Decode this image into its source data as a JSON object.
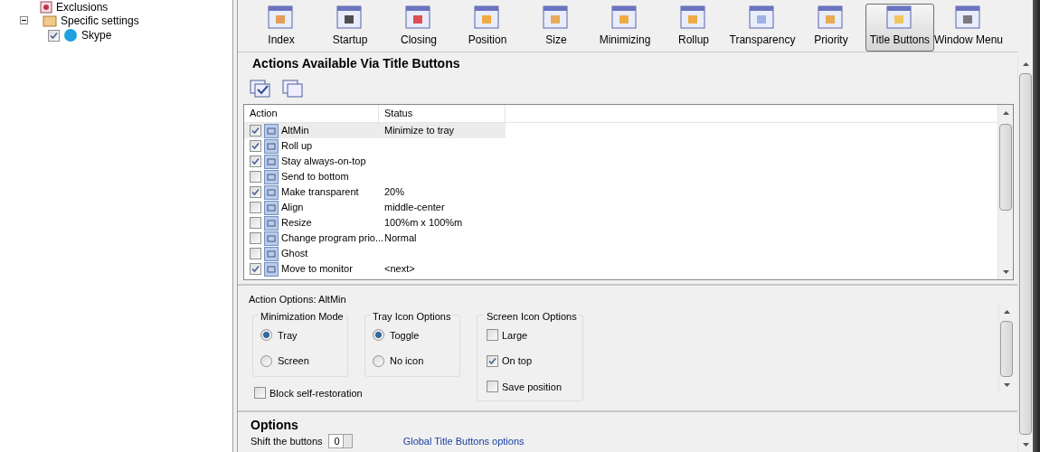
{
  "tree": [
    {
      "label": "Exclusions",
      "kind": "leaf"
    },
    {
      "label": "Specific settings",
      "kind": "folder",
      "expanded": true,
      "children": [
        {
          "label": "Skype",
          "kind": "app",
          "checked": true
        }
      ]
    }
  ],
  "toolbar": [
    {
      "label": "Index",
      "selected": false
    },
    {
      "label": "Startup",
      "selected": false
    },
    {
      "label": "Closing",
      "selected": false
    },
    {
      "label": "Position",
      "selected": false
    },
    {
      "label": "Size",
      "selected": false
    },
    {
      "label": "Minimizing",
      "selected": false
    },
    {
      "label": "Rollup",
      "selected": false
    },
    {
      "label": "Transparency",
      "selected": false
    },
    {
      "label": "Priority",
      "selected": false
    },
    {
      "label": "Title Buttons",
      "selected": true
    },
    {
      "label": "Window Menu",
      "selected": false
    }
  ],
  "actions": {
    "title": "Actions Available Via Title Buttons",
    "columns": [
      "Action",
      "Status"
    ],
    "rows": [
      {
        "action": "AltMin",
        "status": "Minimize to tray",
        "checked": true,
        "selected": true
      },
      {
        "action": "Roll up",
        "status": "",
        "checked": true,
        "selected": false
      },
      {
        "action": "Stay always-on-top",
        "status": "",
        "checked": true,
        "selected": false
      },
      {
        "action": "Send to bottom",
        "status": "",
        "checked": false,
        "selected": false
      },
      {
        "action": "Make transparent",
        "status": "20%",
        "checked": true,
        "selected": false
      },
      {
        "action": "Align",
        "status": "middle-center",
        "checked": false,
        "selected": false
      },
      {
        "action": "Resize",
        "status": "100%m x 100%m",
        "checked": false,
        "selected": false
      },
      {
        "action": "Change program prio...",
        "status": "Normal",
        "checked": false,
        "selected": false
      },
      {
        "action": "Ghost",
        "status": "",
        "checked": false,
        "selected": false
      },
      {
        "action": "Move to monitor",
        "status": "<next>",
        "checked": true,
        "selected": false
      }
    ]
  },
  "action_options": {
    "title": "Action Options: AltMin",
    "radio_groups": [
      {
        "title": "Minimization Mode",
        "options": [
          {
            "label": "Tray",
            "selected": true
          },
          {
            "label": "Screen",
            "selected": false
          }
        ]
      },
      {
        "title": "Tray Icon Options",
        "options": [
          {
            "label": "Toggle",
            "selected": true
          },
          {
            "label": "No icon",
            "selected": false
          }
        ]
      }
    ],
    "block_self_restoration": {
      "label": "Block self-restoration",
      "checked": false
    },
    "screen_icon_options": {
      "title": "Screen Icon Options",
      "items": [
        {
          "label": "Large",
          "checked": false
        },
        {
          "label": "On top",
          "checked": true
        },
        {
          "label": "Save position",
          "checked": false
        }
      ]
    }
  },
  "options": {
    "title": "Options",
    "shift_label": "Shift the buttons",
    "shift_value": "0",
    "link": "Global Title Buttons options"
  }
}
